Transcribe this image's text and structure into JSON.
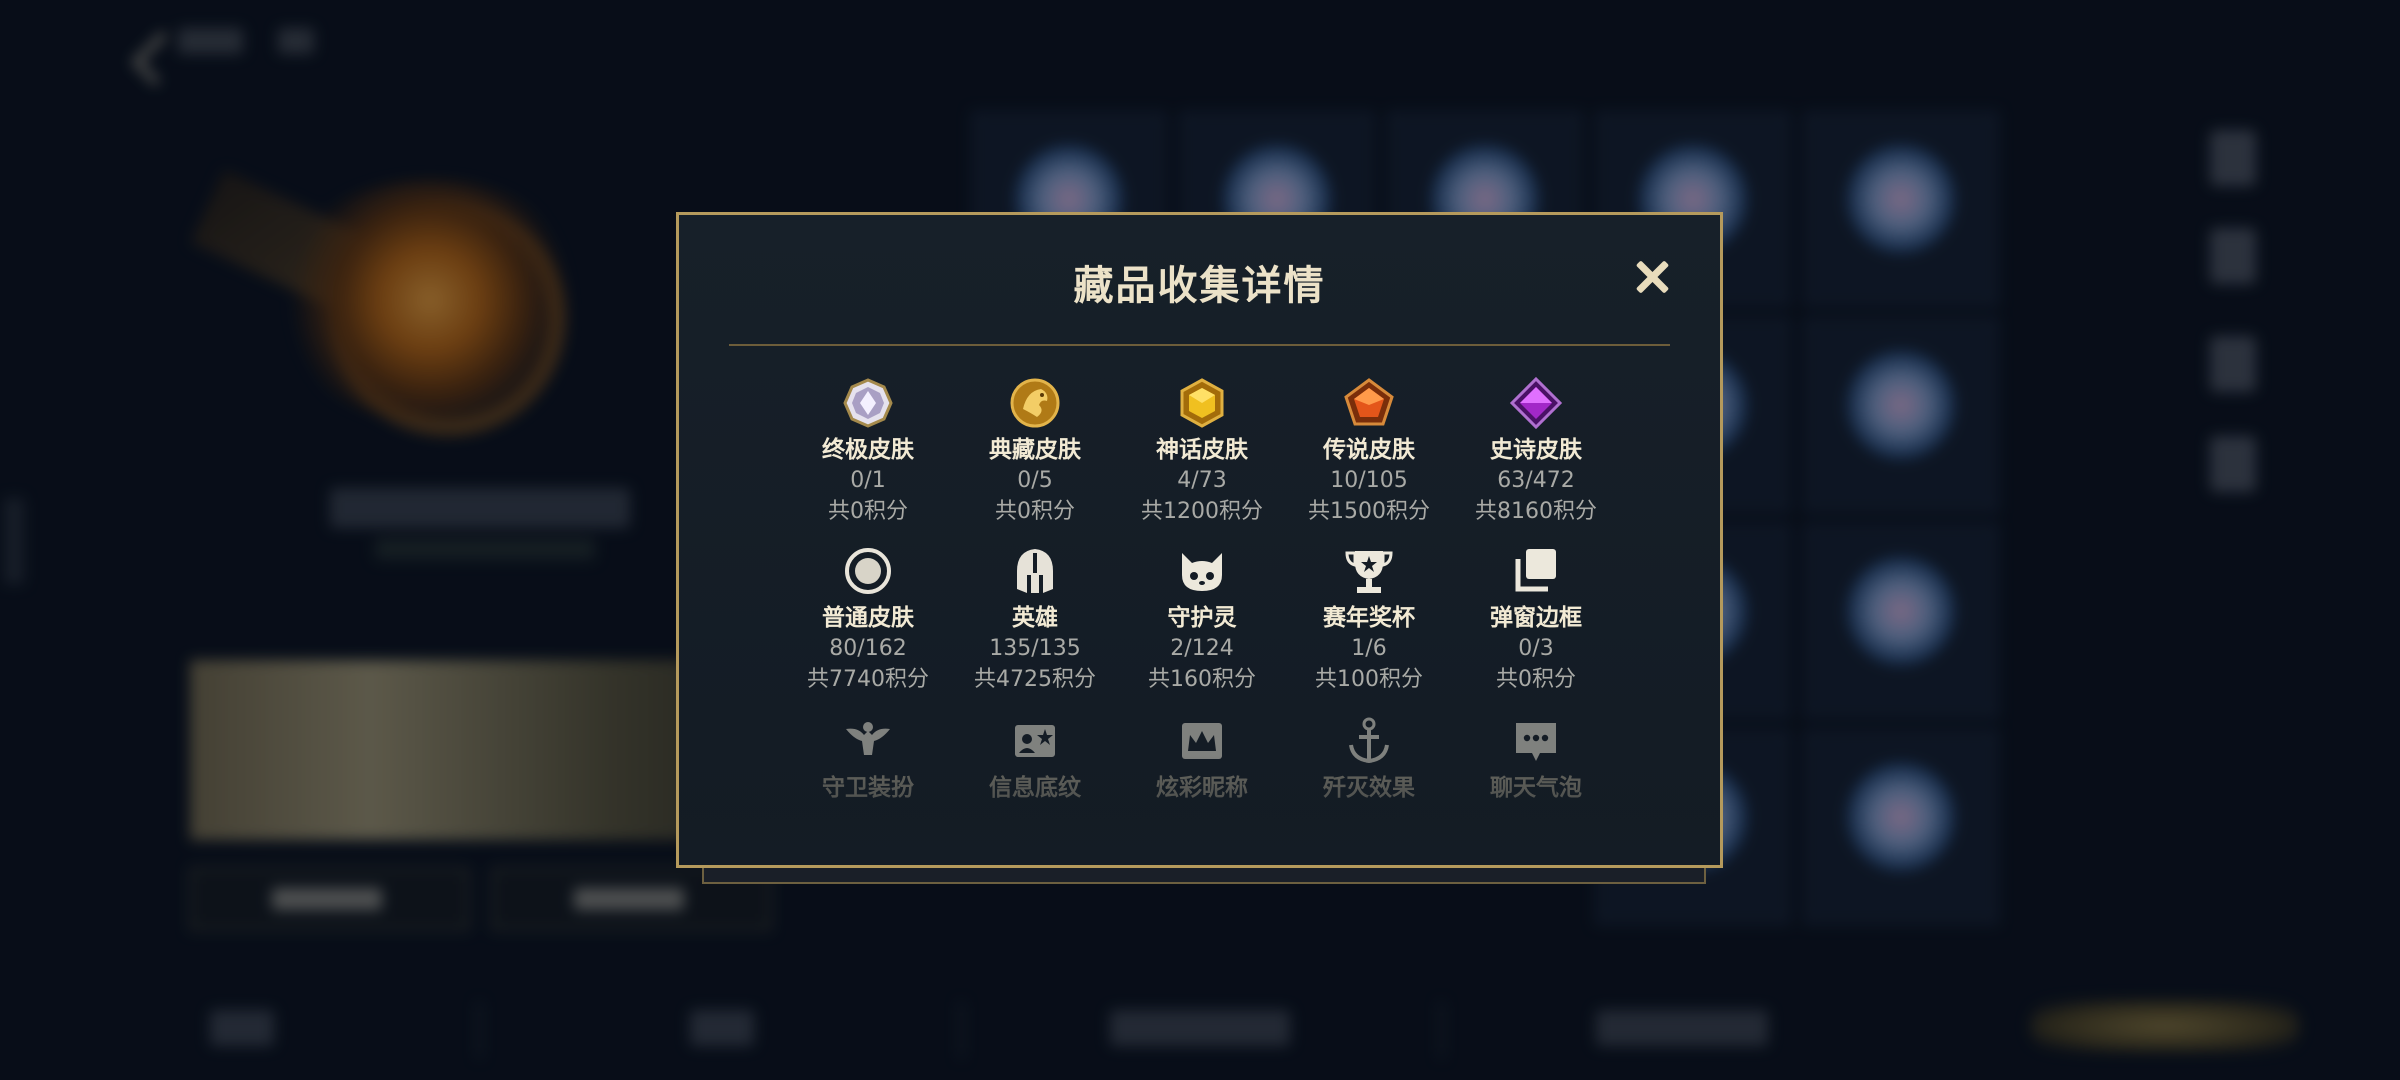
{
  "modal": {
    "title": "藏品收集详情"
  },
  "stats": [
    {
      "id": "ultimate",
      "name": "终极皮肤",
      "count": "0/1",
      "points": "共0积分",
      "icon": "ultimate-skin-gem-icon"
    },
    {
      "id": "treasure",
      "name": "典藏皮肤",
      "count": "0/5",
      "points": "共0积分",
      "icon": "treasure-skin-dragon-icon"
    },
    {
      "id": "mythic",
      "name": "神话皮肤",
      "count": "4/73",
      "points": "共1200积分",
      "icon": "mythic-skin-gem-icon"
    },
    {
      "id": "legendary",
      "name": "传说皮肤",
      "count": "10/105",
      "points": "共1500积分",
      "icon": "legendary-skin-gem-icon"
    },
    {
      "id": "epic",
      "name": "史诗皮肤",
      "count": "63/472",
      "points": "共8160积分",
      "icon": "epic-skin-gem-icon"
    },
    {
      "id": "normal",
      "name": "普通皮肤",
      "count": "80/162",
      "points": "共7740积分",
      "icon": "normal-skin-circle-icon"
    },
    {
      "id": "hero",
      "name": "英雄",
      "count": "135/135",
      "points": "共4725积分",
      "icon": "hero-helmet-icon"
    },
    {
      "id": "guardian",
      "name": "守护灵",
      "count": "2/124",
      "points": "共160积分",
      "icon": "guardian-spirit-icon"
    },
    {
      "id": "trophy",
      "name": "赛年奖杯",
      "count": "1/6",
      "points": "共100积分",
      "icon": "trophy-icon"
    },
    {
      "id": "frame",
      "name": "弹窗边框",
      "count": "0/3",
      "points": "共0积分",
      "icon": "popup-frame-icon"
    },
    {
      "id": "guard_costume",
      "name": "守卫装扮",
      "icon": "guard-costume-icon"
    },
    {
      "id": "info_pattern",
      "name": "信息底纹",
      "icon": "info-pattern-icon"
    },
    {
      "id": "colorful_name",
      "name": "炫彩昵称",
      "icon": "colorful-nickname-icon"
    },
    {
      "id": "kill_effect",
      "name": "歼灭效果",
      "icon": "kill-effect-icon"
    },
    {
      "id": "chat_bubble",
      "name": "聊天气泡",
      "icon": "chat-bubble-icon"
    }
  ],
  "colors": {
    "modal_border": "#b59a5c",
    "modal_bg": "#172029",
    "title_text": "#ece2c8",
    "label_text": "#f2ead4",
    "sub_text": "#a9aaa6"
  }
}
